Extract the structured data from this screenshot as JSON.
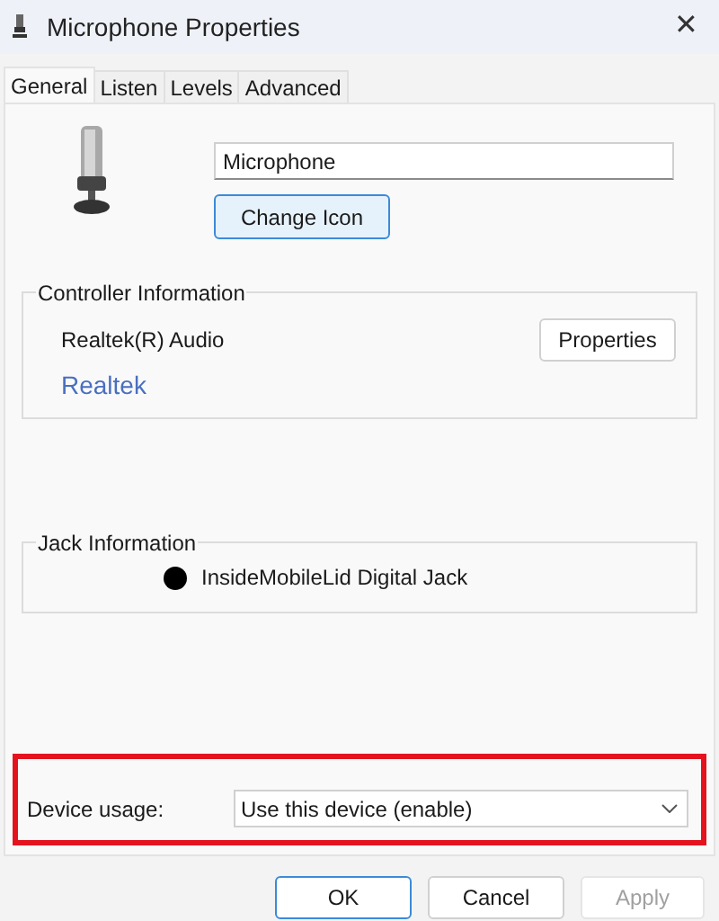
{
  "window": {
    "title": "Microphone Properties",
    "close": "✕"
  },
  "tabs": [
    {
      "label": "General",
      "selected": true
    },
    {
      "label": "Listen",
      "selected": false
    },
    {
      "label": "Levels",
      "selected": false
    },
    {
      "label": "Advanced",
      "selected": false
    }
  ],
  "device_name": {
    "value": "Microphone"
  },
  "change_icon_button": "Change Icon",
  "controller": {
    "legend": "Controller Information",
    "name": "Realtek(R) Audio",
    "properties_button": "Properties",
    "link": "Realtek"
  },
  "jack": {
    "legend": "Jack Information",
    "name": "InsideMobileLid Digital Jack",
    "color": "#000000"
  },
  "device_usage": {
    "label": "Device usage:",
    "value": "Use this device (enable)",
    "highlighted": true
  },
  "buttons": [
    {
      "label": "OK",
      "kind": "default",
      "disabled": false
    },
    {
      "label": "Cancel",
      "kind": "normal",
      "disabled": false
    },
    {
      "label": "Apply",
      "kind": "normal",
      "disabled": true
    }
  ]
}
